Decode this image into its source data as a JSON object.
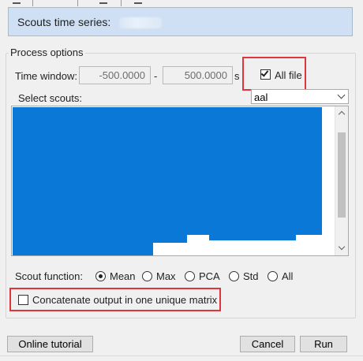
{
  "header": {
    "title": "Scouts time series:"
  },
  "process_options": {
    "legend": "Process options",
    "time_window": {
      "label": "Time window:",
      "start": "-500.0000",
      "separator": "-",
      "end": "500.0000",
      "unit": "s"
    },
    "all_file": {
      "label": "All file",
      "checked": true
    },
    "select_scouts": {
      "label": "Select scouts:",
      "atlas": "aal"
    },
    "scout_function": {
      "label": "Scout function:",
      "options": [
        "Mean",
        "Max",
        "PCA",
        "Std",
        "All"
      ],
      "selected": "Mean"
    },
    "concatenate": {
      "label": "Concatenate output in one unique matrix",
      "checked": false
    }
  },
  "buttons": {
    "online_tutorial": "Online tutorial",
    "cancel": "Cancel",
    "run": "Run"
  },
  "colors": {
    "highlight_red": "#e0353d",
    "header_bg": "#cfe0f4",
    "selection_blue": "#0a78d7"
  }
}
